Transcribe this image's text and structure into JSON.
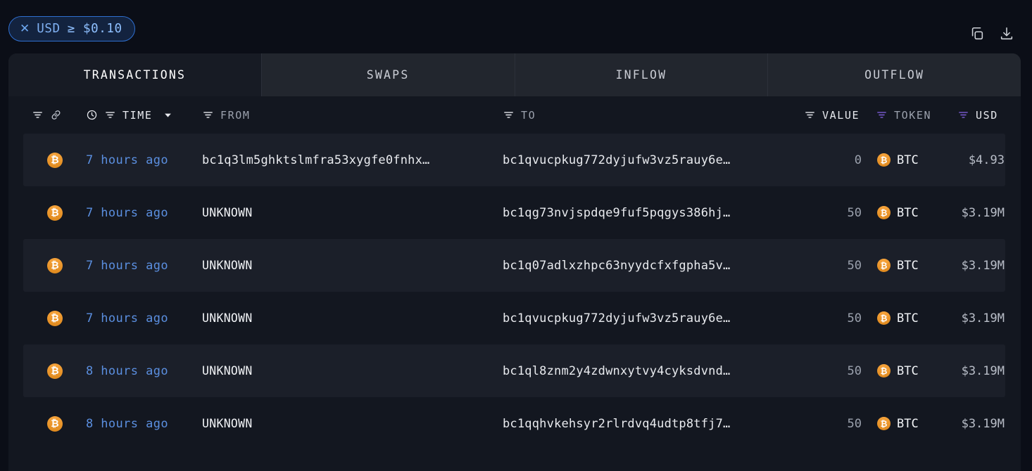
{
  "topbar": {
    "filter_chip": {
      "remove_icon": "close-icon",
      "label": "USD",
      "value": "≥ $0.10"
    },
    "actions": [
      {
        "name": "copy-icon",
        "title": "Copy"
      },
      {
        "name": "download-icon",
        "title": "Download"
      }
    ]
  },
  "tabs": [
    {
      "label": "TRANSACTIONS",
      "active": true
    },
    {
      "label": "SWAPS",
      "active": false
    },
    {
      "label": "INFLOW",
      "active": false
    },
    {
      "label": "OUTFLOW",
      "active": false
    }
  ],
  "columns": {
    "filter_icon": "filter-icon",
    "chain_icon": "link-icon",
    "clock_icon": "clock-icon",
    "sort_icon": "chevron-down-icon",
    "time": "TIME",
    "from": "FROM",
    "to": "TO",
    "value": "VALUE",
    "token": "TOKEN",
    "usd": "USD"
  },
  "colors": {
    "accent_blue": "#5b8fe0",
    "chip_border": "#2f6fd0",
    "chip_bg": "#13233f",
    "bitcoin_orange": "#e08a1e",
    "filter_active_purple": "#7c5cd6",
    "panel_bg": "#131720",
    "row_stripe": "#1b1f29"
  },
  "rows": [
    {
      "asset_icon": "bitcoin-icon",
      "time": "7 hours ago",
      "from": "bc1q3lm5ghktslmfra53xygfe0fnhx…",
      "from_unknown": false,
      "to": "bc1qvucpkug772dyjufw3vz5rauy6e…",
      "value": "0",
      "token": "BTC",
      "usd": "$4.93"
    },
    {
      "asset_icon": "bitcoin-icon",
      "time": "7 hours ago",
      "from": "UNKNOWN",
      "from_unknown": true,
      "to": "bc1qg73nvjspdqe9fuf5pqgys386hj…",
      "value": "50",
      "token": "BTC",
      "usd": "$3.19M"
    },
    {
      "asset_icon": "bitcoin-icon",
      "time": "7 hours ago",
      "from": "UNKNOWN",
      "from_unknown": true,
      "to": "bc1q07adlxzhpc63nyydcfxfgpha5v…",
      "value": "50",
      "token": "BTC",
      "usd": "$3.19M"
    },
    {
      "asset_icon": "bitcoin-icon",
      "time": "7 hours ago",
      "from": "UNKNOWN",
      "from_unknown": true,
      "to": "bc1qvucpkug772dyjufw3vz5rauy6e…",
      "value": "50",
      "token": "BTC",
      "usd": "$3.19M"
    },
    {
      "asset_icon": "bitcoin-icon",
      "time": "8 hours ago",
      "from": "UNKNOWN",
      "from_unknown": true,
      "to": "bc1ql8znm2y4zdwnxytvy4cyksdvnd…",
      "value": "50",
      "token": "BTC",
      "usd": "$3.19M"
    },
    {
      "asset_icon": "bitcoin-icon",
      "time": "8 hours ago",
      "from": "UNKNOWN",
      "from_unknown": true,
      "to": "bc1qqhvkehsyr2rlrdvq4udtp8tfj7…",
      "value": "50",
      "token": "BTC",
      "usd": "$3.19M"
    }
  ]
}
